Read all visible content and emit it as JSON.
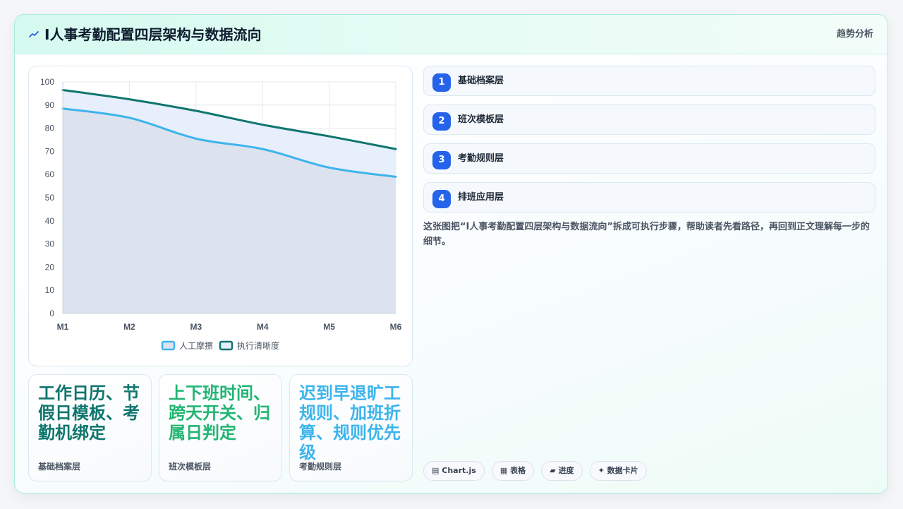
{
  "header": {
    "title": "I人事考勤配置四层架构与数据流向",
    "action": "趋势分析",
    "icon": "sparkline-icon"
  },
  "chart_data": {
    "type": "area",
    "categories": [
      "M1",
      "M2",
      "M3",
      "M4",
      "M5",
      "M6"
    ],
    "series": [
      {
        "name": "人工摩擦",
        "values": [
          88.5,
          84.5,
          75.5,
          71,
          63,
          59
        ],
        "color": "#3db4ec",
        "fill": "#dde3ee"
      },
      {
        "name": "执行清晰度",
        "values": [
          96.5,
          92.5,
          87.5,
          81.5,
          76.5,
          71
        ],
        "color": "#0f766e",
        "fill": "#e7eefc"
      }
    ],
    "yticks": [
      "0",
      "10",
      "20",
      "30",
      "40",
      "50",
      "60",
      "70",
      "80",
      "90",
      "100"
    ],
    "ylim": [
      0,
      100
    ],
    "grid": true,
    "legend_position": "bottom"
  },
  "steps": [
    {
      "num": "1",
      "label": "基础档案层"
    },
    {
      "num": "2",
      "label": "班次模板层"
    },
    {
      "num": "3",
      "label": "考勤规则层"
    },
    {
      "num": "4",
      "label": "排班应用层"
    }
  ],
  "description": "这张图把“I人事考勤配置四层架构与数据流向”拆成可执行步骤，帮助读者先看路径，再回到正文理解每一步的细节。",
  "stats": [
    {
      "value": "工作日历、节假日模板、考勤机绑定",
      "caption": "基础档案层",
      "color": "#0f766e"
    },
    {
      "value": "上下班时间、跨天开关、归属日判定",
      "caption": "班次模板层",
      "color": "#22b573"
    },
    {
      "value": "迟到早退旷工规则、加班折算、规则优先级",
      "caption": "考勤规则层",
      "color": "#3db4ec"
    }
  ],
  "tags": [
    {
      "icon": "chart-icon",
      "glyph": "▤",
      "label": "Chart.js"
    },
    {
      "icon": "table-icon",
      "glyph": "▦",
      "label": "表格"
    },
    {
      "icon": "progress-icon",
      "glyph": "▰",
      "label": "进度"
    },
    {
      "icon": "sparkle-icon",
      "glyph": "✦",
      "label": "数据卡片"
    }
  ]
}
